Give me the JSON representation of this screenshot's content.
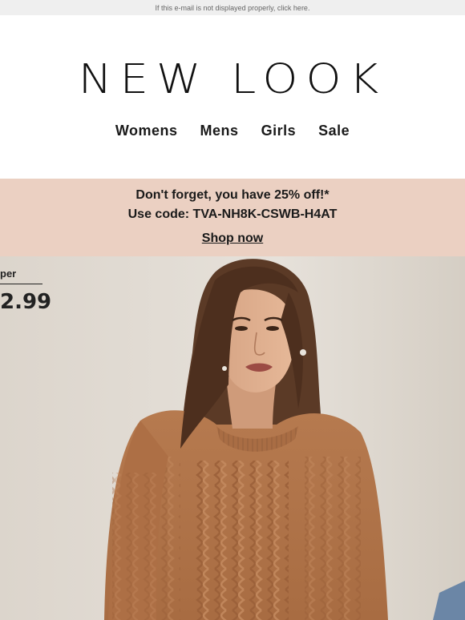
{
  "preheader": {
    "text": "If this e-mail is not displayed properly, click here."
  },
  "brand": {
    "logo_text": "NEW LOOK"
  },
  "nav": {
    "items": [
      {
        "label": "Womens"
      },
      {
        "label": "Mens"
      },
      {
        "label": "Girls"
      },
      {
        "label": "Sale"
      }
    ]
  },
  "promo": {
    "headline": "Don't forget, you have 25% off!*",
    "code_line": "Use code: TVA-NH8K-CSWB-H4AT",
    "cta": "Shop now",
    "background": "#ebd0c2"
  },
  "hero": {
    "badge_label": "per",
    "badge_price": "2.99",
    "image": "model-in-tan-cable-knit-jumper"
  }
}
